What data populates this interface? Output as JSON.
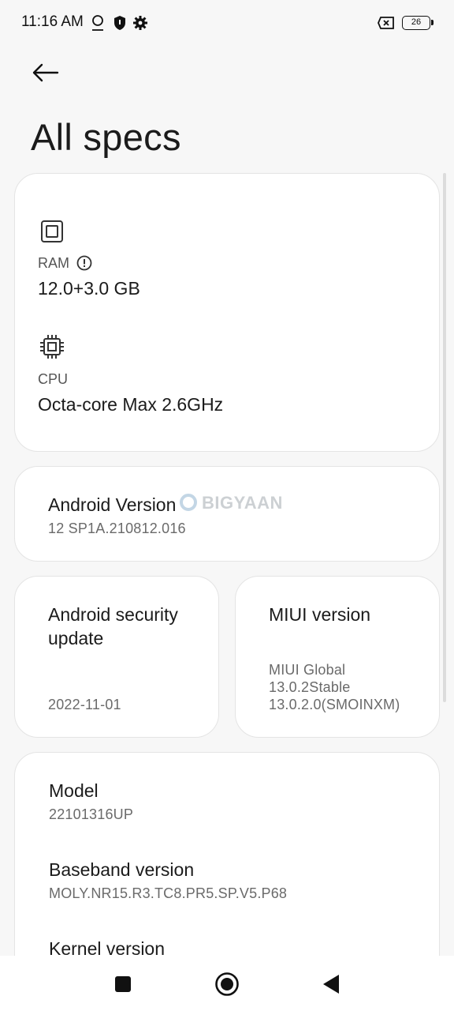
{
  "status_bar": {
    "time": "11:16 AM",
    "battery": "26",
    "icons": [
      "face-unlock-icon",
      "shield-icon",
      "settings-gear-icon",
      "no-sim-icon",
      "battery-icon"
    ]
  },
  "header": {
    "back_icon": "arrow-left-icon",
    "title": "All specs"
  },
  "hardware": {
    "ram": {
      "icon": "chip-icon",
      "label": "RAM",
      "info_icon": "info-circle-icon",
      "value": "12.0+3.0 GB"
    },
    "cpu": {
      "icon": "cpu-icon",
      "label": "CPU",
      "value": "Octa-core Max 2.6GHz"
    }
  },
  "android_version": {
    "title": "Android Version",
    "value": "12 SP1A.210812.016"
  },
  "watermark": "BIGYAAN",
  "security_update": {
    "title_line1": "Android security",
    "title_line2": "update",
    "value": "2022-11-01"
  },
  "miui_version": {
    "title": "MIUI version",
    "line1": "MIUI Global",
    "line2": "13.0.2Stable",
    "line3": "13.0.2.0(SMOINXM)"
  },
  "device_info": {
    "model": {
      "title": "Model",
      "value": "22101316UP"
    },
    "baseband": {
      "title": "Baseband version",
      "value": "MOLY.NR15.R3.TC8.PR5.SP.V5.P68"
    },
    "kernel": {
      "title": "Kernel version"
    }
  },
  "nav_bar": {
    "recents_icon": "square-recents-icon",
    "home_icon": "circle-home-icon",
    "back_icon": "triangle-back-icon"
  },
  "colors": {
    "background": "#f7f7f7",
    "card": "#ffffff",
    "text_primary": "#1b1b1b",
    "text_secondary": "#6a6a6a"
  }
}
